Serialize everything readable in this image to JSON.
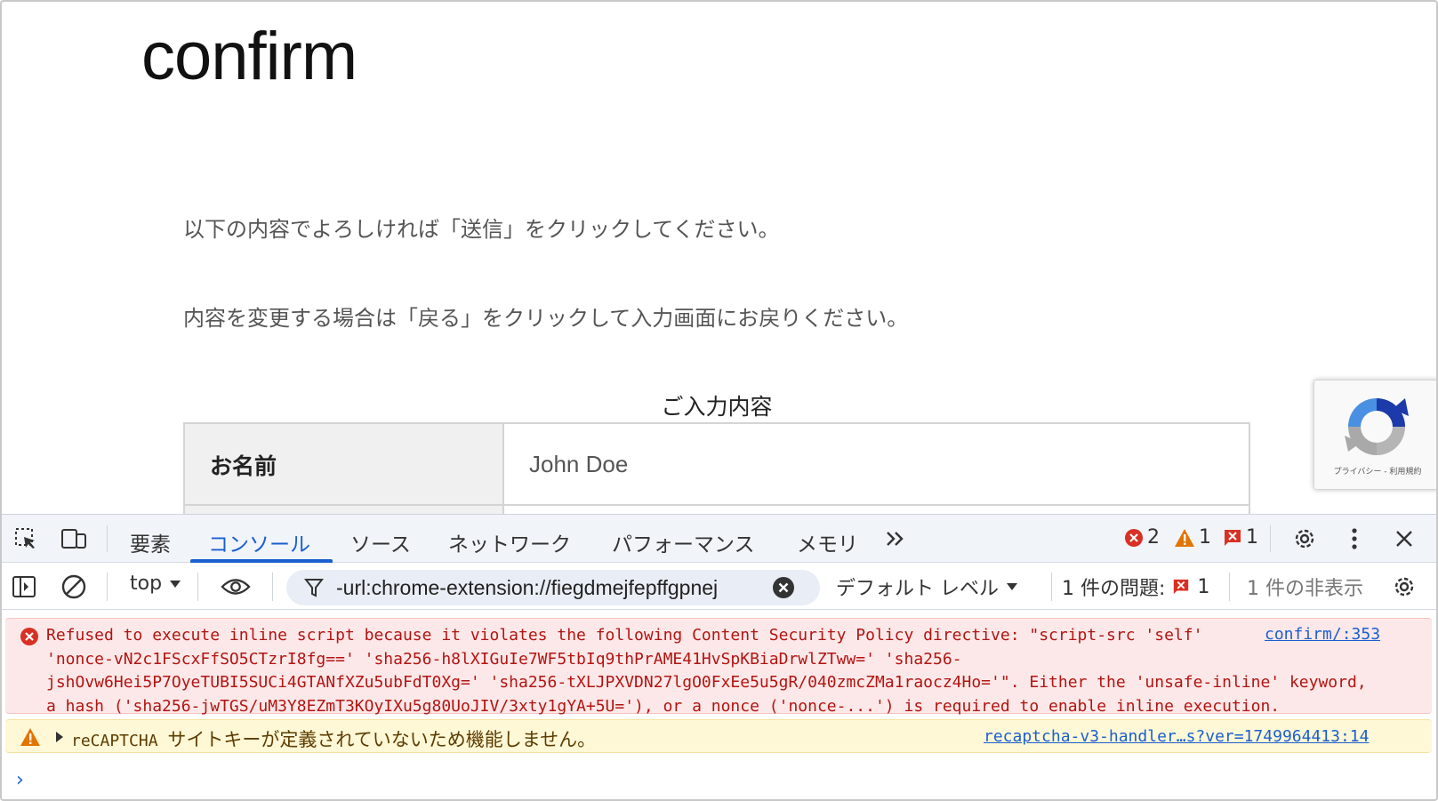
{
  "page": {
    "title": "confirm",
    "paragraph1": "以下の内容でよろしければ「送信」をクリックしてください。",
    "paragraph2": "内容を変更する場合は「戻る」をクリックして入力画面にお戻りください。",
    "caption": "ご入力内容",
    "table": {
      "rows": [
        {
          "label": "お名前",
          "value": "John Doe"
        },
        {
          "label": "",
          "value": ""
        }
      ]
    },
    "recaptcha_text": "プライバシー - 利用規約"
  },
  "devtools": {
    "tabs": [
      "要素",
      "コンソール",
      "ソース",
      "ネットワーク",
      "パフォーマンス",
      "メモリ"
    ],
    "active_tab": "コンソール",
    "more_tabs_icon": "double-chevron-icon",
    "error_count": "2",
    "warning_count": "1",
    "issue_count": "1",
    "toolbar": {
      "context": "top",
      "filter_value": "-url:chrome-extension://fiegdmejfepffgpnej",
      "level": "デフォルト レベル",
      "issues_label": "1 件の問題:",
      "issues_count": "1",
      "hidden_label": "1 件の非表示"
    },
    "messages": {
      "error": {
        "text": "Refused to execute inline script because it violates the following Content Security Policy directive: \"script-src 'self'\n'nonce-vN2c1FScxFfSO5CTzrI8fg==' 'sha256-h8lXIGuIe7WF5tbIq9thPrAME41HvSpKBiaDrwlZTww=' 'sha256-\njshOvw6Hei5P7OyeTUBI5SUCi4GTANfXZu5ubFdT0Xg=' 'sha256-tXLJPXVDN27lgO0FxEe5u5gR/040zmcZMa1raocz4Ho='\". Either the 'unsafe-inline' keyword,\na hash ('sha256-jwTGS/uM3Y8EZmT3KOyIXu5g80UoJIV/3xty1gYA+5U='), or a nonce ('nonce-...') is required to enable inline execution.",
        "source": "confirm/:353"
      },
      "warning": {
        "prefix": "reCAPTCHA",
        "text": "サイトキーが定義されていないため機能しません。",
        "source": "recaptcha-v3-handler…s?ver=1749964413:14"
      }
    },
    "prompt": "›"
  },
  "colors": {
    "accent": "#1a5fd0",
    "error_bg": "#fce8e8",
    "error_text": "#b31412",
    "warning_bg": "#fff8d6"
  }
}
